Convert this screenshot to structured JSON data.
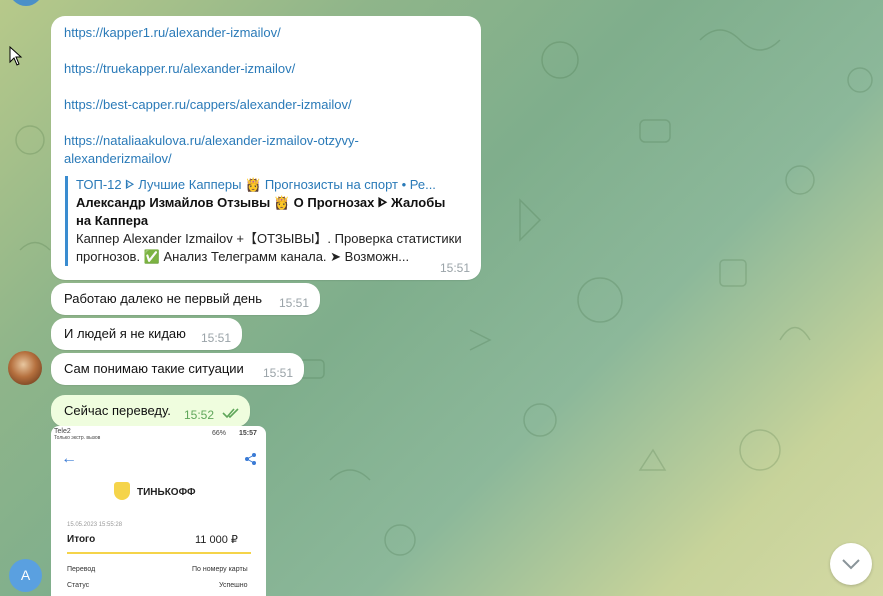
{
  "chat": {
    "link_message": {
      "links": [
        "https://kapper1.ru/alexander-izmailov/",
        "https://truekapper.ru/alexander-izmailov/",
        "https://best-capper.ru/cappers/alexander-izmailov/",
        "https://nataliaakulova.ru/alexander-izmailov-otzyvy-",
        "alexanderizmailov/"
      ],
      "preview": {
        "site": "ТОП-12 ᐈ Лучшие Капперы 👸 Прогнозисты на спорт • Ре...",
        "title_line1": "Александр Измайлов Отзывы 👸 О Прогнозах ᐈ Жалобы",
        "title_line2": "на Каппера",
        "desc_line1": "Каппер Alexander Izmailov +【ОТЗЫВЫ】. Проверка статистики",
        "desc_line2": "прогнозов. ✅ Анализ Телеграмм канала. ➤ Возможн..."
      },
      "time": "15:51"
    },
    "messages": [
      {
        "text": "Работаю далеко не первый день",
        "time": "15:51"
      },
      {
        "text": "И людей я не кидаю",
        "time": "15:51"
      },
      {
        "text": "Сам понимаю такие ситуации",
        "time": "15:51"
      }
    ],
    "outgoing": {
      "text": "Сейчас переведу.",
      "time": "15:52",
      "status_icon": "double-check-icon"
    },
    "my_avatar_letter": "A",
    "screenshot": {
      "status_left": "Tele2",
      "status_sub": "Только экстр. вызов",
      "battery": "66%",
      "clock": "15:57",
      "brand": "ТИНЬКОФФ",
      "date": "15.05.2023 15:55:28",
      "total_label": "Итого",
      "total_value": "11 000 ₽",
      "rows": [
        {
          "label": "Перевод",
          "value": "По номеру карты"
        },
        {
          "label": "Статус",
          "value": "Успешно"
        }
      ]
    }
  }
}
